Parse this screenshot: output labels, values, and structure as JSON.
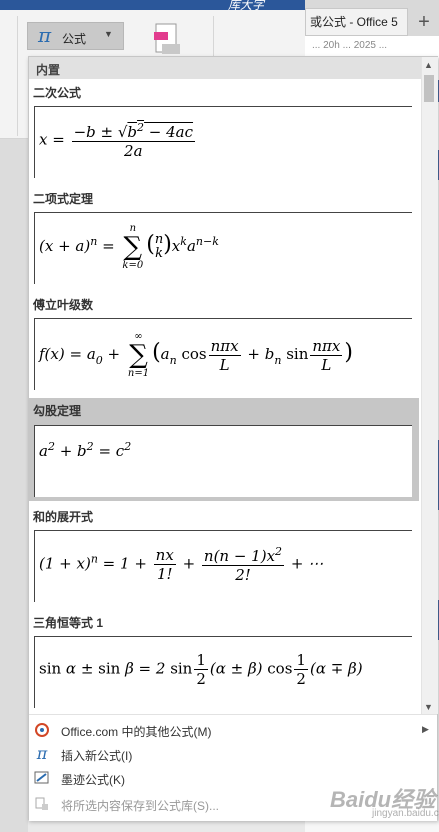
{
  "ribbon": {
    "top_text": "库大字",
    "formula_button_label": "公式",
    "formula_icon": "π",
    "dropdown_icon": "chevron-down-icon"
  },
  "browser": {
    "tab_label": "或公式 - Office 5",
    "address_text": "... 20h ... 2025 ..."
  },
  "panel": {
    "header": "内置",
    "sections": [
      {
        "title": "二次公式"
      },
      {
        "title": "二项式定理"
      },
      {
        "title": "傅立叶级数"
      },
      {
        "title": "勾股定理",
        "selected": true
      },
      {
        "title": "和的展开式"
      },
      {
        "title": "三角恒等式 1"
      }
    ]
  },
  "footer": {
    "items": [
      {
        "label": "Office.com 中的其他公式(M)",
        "icon": "office-icon",
        "has_submenu": true,
        "enabled": true
      },
      {
        "label": "插入新公式(I)",
        "icon": "pi-icon",
        "enabled": true
      },
      {
        "label": "墨迹公式(K)",
        "icon": "ink-icon",
        "enabled": true
      },
      {
        "label": "将所选内容保存到公式库(S)...",
        "icon": "save-gallery-icon",
        "enabled": false
      }
    ]
  },
  "watermark": {
    "text": "Baidu经验",
    "sub": "jingyan.baidu.com"
  }
}
